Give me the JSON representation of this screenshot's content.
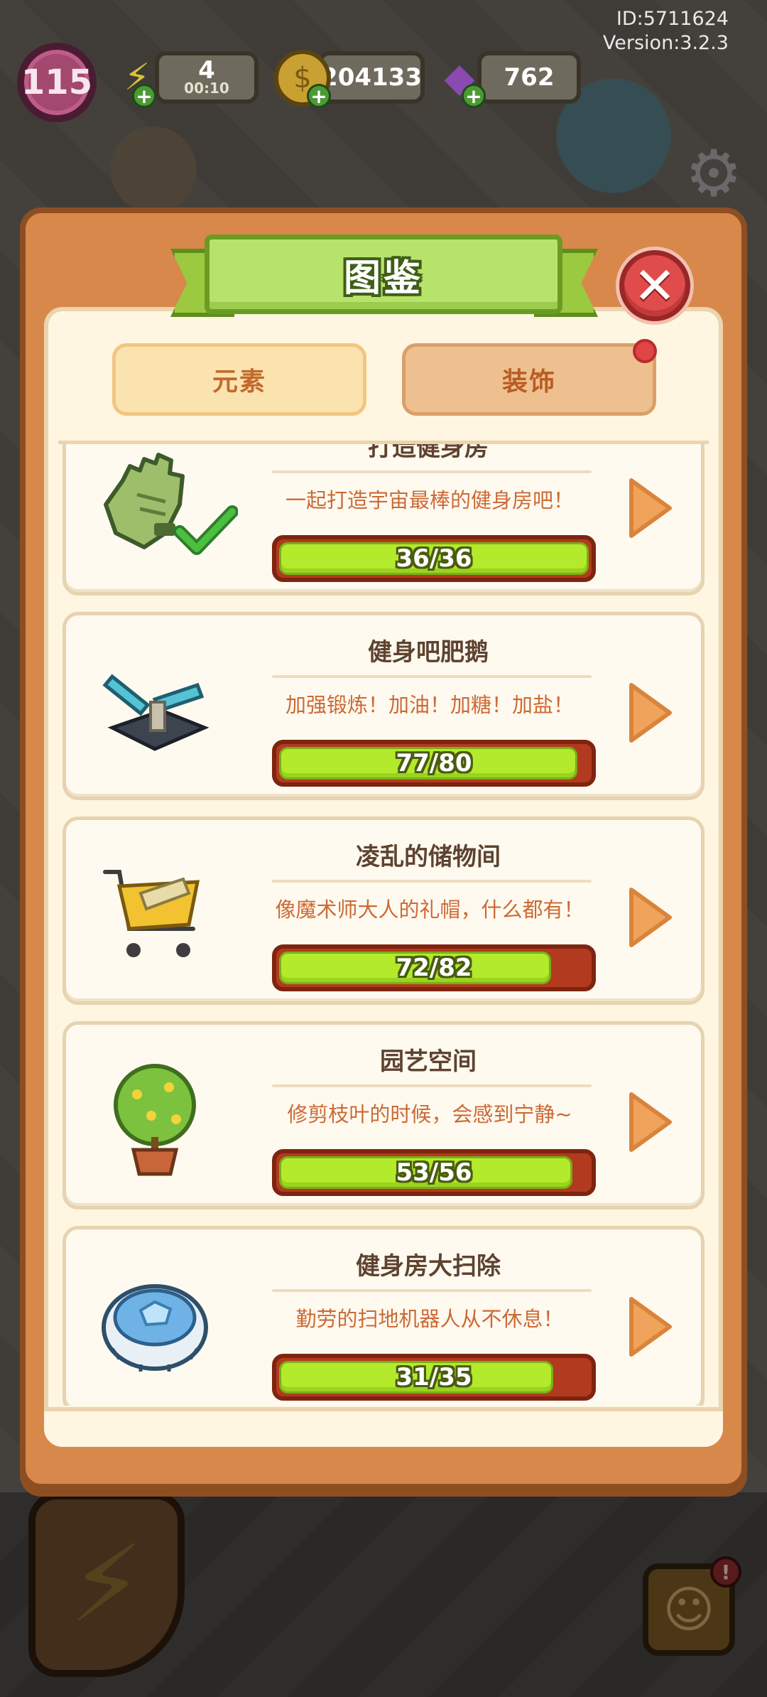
{
  "hud": {
    "id_text": "ID:5711624",
    "version_text": "Version:3.2.3",
    "level": "115",
    "energy": {
      "value": "4",
      "timer": "00:10"
    },
    "coins": "204133",
    "gems": "762"
  },
  "modal": {
    "title": "图鉴",
    "tabs": [
      {
        "label": "元素",
        "active": false
      },
      {
        "label": "装饰",
        "active": true,
        "has_notification_dot": true
      }
    ],
    "collections": [
      {
        "name": "打造健身房",
        "description": "一起打造宇宙最棒的健身房吧！",
        "progress_text": "36/36",
        "current": 36,
        "total": 36,
        "icon": "glove-icon",
        "completed": true
      },
      {
        "name": "健身吧肥鹅",
        "description": "加强锻炼！加油！加糖！加盐！",
        "progress_text": "77/80",
        "current": 77,
        "total": 80,
        "icon": "exercise-machine-icon",
        "completed": false
      },
      {
        "name": "凌乱的储物间",
        "description": "像魔术师大人的礼帽，什么都有！",
        "progress_text": "72/82",
        "current": 72,
        "total": 82,
        "icon": "shopping-cart-icon",
        "completed": false
      },
      {
        "name": "园艺空间",
        "description": "修剪枝叶的时候，会感到宁静~",
        "progress_text": "53/56",
        "current": 53,
        "total": 56,
        "icon": "potted-tree-icon",
        "completed": false
      },
      {
        "name": "健身房大扫除",
        "description": "勤劳的扫地机器人从不休息！",
        "progress_text": "31/35",
        "current": 31,
        "total": 35,
        "icon": "robot-vacuum-icon",
        "completed": false
      }
    ]
  },
  "colors": {
    "modal_orange": "#d9884b",
    "ribbon_green": "#b8e36b",
    "progress_green": "#b3ea2c",
    "progress_red": "#b23a1e",
    "close_red": "#e04c4c",
    "arrow_orange": "#f0a35a"
  }
}
